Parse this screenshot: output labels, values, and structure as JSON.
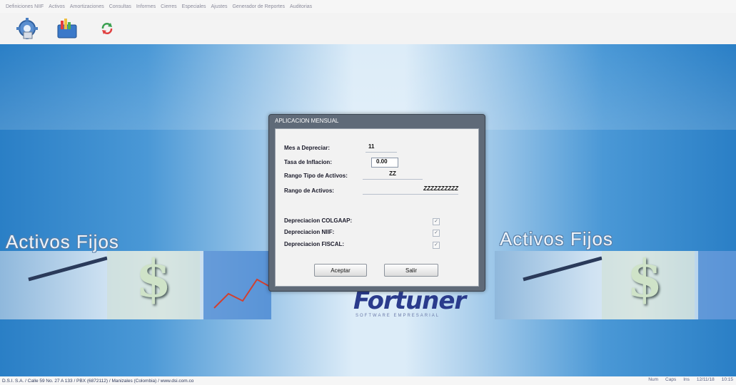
{
  "menu": [
    "Definiciones NIIF",
    "Activos",
    "Amortizaciones",
    "Consultas",
    "Informes",
    "Cierres",
    "Especiales",
    "Ajustes",
    "Generador de Reportes",
    "Auditorias"
  ],
  "toolbar": {
    "icons": [
      "gear-icon",
      "folder-chart-icon",
      "refresh-icon"
    ]
  },
  "brand": {
    "left": "Activos Fijos",
    "right": "Activos Fijos",
    "logo": "Fortuner",
    "logo_sub": "SOFTWARE EMPRESARIAL"
  },
  "dialog": {
    "title": "APLICACION MENSUAL",
    "mes_label": "Mes a Depreciar:",
    "mes_value": "11",
    "tasa_label": "Tasa de Inflacion:",
    "tasa_value": "0.00",
    "rango_tipo_label": "Rango Tipo de Activos:",
    "rango_tipo_value": "ZZ",
    "rango_activos_label": "Rango de Activos:",
    "rango_activos_value": "ZZZZZZZZZZ",
    "colgaap_label": "Depreciacion COLGAAP:",
    "niif_label": "Depreciacion NIIF:",
    "fiscal_label": "Depreciacion FISCAL:",
    "check_mark": "✓",
    "accept_label": "Aceptar",
    "exit_label": "Salir"
  },
  "status": {
    "left": "D.S.I. S.A. / Calle 59 No. 27 A 133 / PBX (6872112) / Manizales (Colombia) / www.dsi.com.co",
    "num": "Num",
    "caps": "Caps",
    "ins": "Ins",
    "date": "12/11/18",
    "time": "10:15"
  }
}
